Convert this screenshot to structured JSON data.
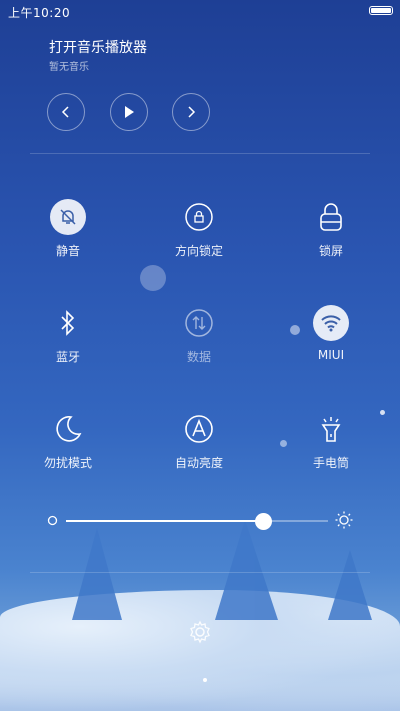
{
  "status_bar": {
    "time": "上午10:20",
    "battery_level": 1.0
  },
  "music": {
    "title": "打开音乐播放器",
    "subtitle": "暂无音乐",
    "prev_icon": "chevron-left-icon",
    "play_icon": "play-icon",
    "next_icon": "chevron-right-icon"
  },
  "toggles": [
    {
      "label": "静音",
      "icon": "bell-off-icon",
      "active": true
    },
    {
      "label": "方向锁定",
      "icon": "rotation-lock-icon",
      "active": false
    },
    {
      "label": "锁屏",
      "icon": "lock-icon",
      "active": false
    },
    {
      "label": "蓝牙",
      "icon": "bluetooth-icon",
      "active": false
    },
    {
      "label": "数据",
      "icon": "data-arrows-icon",
      "active": false
    },
    {
      "label": "MIUI",
      "icon": "wifi-icon",
      "active": true
    },
    {
      "label": "勿扰模式",
      "icon": "moon-icon",
      "active": false
    },
    {
      "label": "自动亮度",
      "icon": "auto-brightness-icon",
      "active": false
    },
    {
      "label": "手电筒",
      "icon": "flashlight-icon",
      "active": false
    }
  ],
  "brightness": {
    "level": 0.75,
    "low_icon": "brightness-low-icon",
    "high_icon": "brightness-high-icon"
  },
  "settings_icon": "gear-icon",
  "colors": {
    "accent": "#ffffff",
    "background_top": "#1e3f95",
    "background_bottom": "#8cb7e0",
    "active_icon": "#3a5fa8"
  }
}
